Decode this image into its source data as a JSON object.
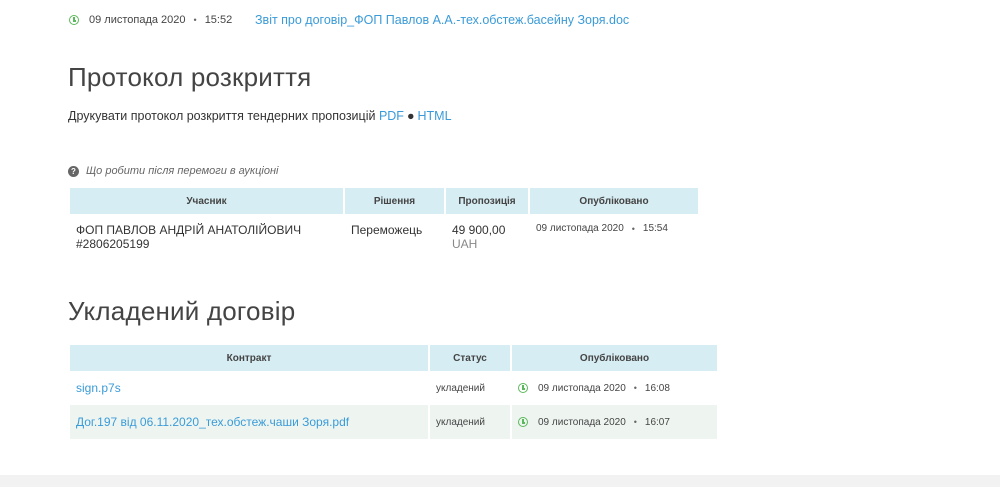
{
  "top": {
    "date": "09 листопада 2020",
    "time": "15:52",
    "link": "Звіт про договір_ФОП Павлов А.А.-тех.обстеж.басейну Зоря.doc"
  },
  "protocol": {
    "title": "Протокол розкриття",
    "print_text": "Друкувати протокол розкриття тендерних пропозицій",
    "pdf": "PDF",
    "html": "HTML",
    "help": "Що робити після перемоги в аукціоні",
    "headers": [
      "Учасник",
      "Рішення",
      "Пропозиція",
      "Опубліковано"
    ],
    "row": {
      "participant": "ФОП ПАВЛОВ АНДРІЙ АНАТОЛІЙОВИЧ",
      "code": "#2806205199",
      "decision": "Переможець",
      "amount": "49 900,00",
      "currency": "UAH",
      "date": "09 листопада 2020",
      "time": "15:54"
    }
  },
  "contract": {
    "title": "Укладений договір",
    "headers": [
      "Контракт",
      "Статус",
      "Опубліковано"
    ],
    "rows": [
      {
        "file": "sign.p7s",
        "status": "укладений",
        "date": "09 листопада 2020",
        "time": "16:08"
      },
      {
        "file": "Дог.197 від 06.11.2020_тех.обстеж.чаши Зоря.pdf",
        "status": "укладений",
        "date": "09 листопада 2020",
        "time": "16:07"
      }
    ]
  },
  "colors": {
    "accent": "#3a9bd8",
    "header_bg": "#d6edf3",
    "clock": "#5cb85c"
  }
}
